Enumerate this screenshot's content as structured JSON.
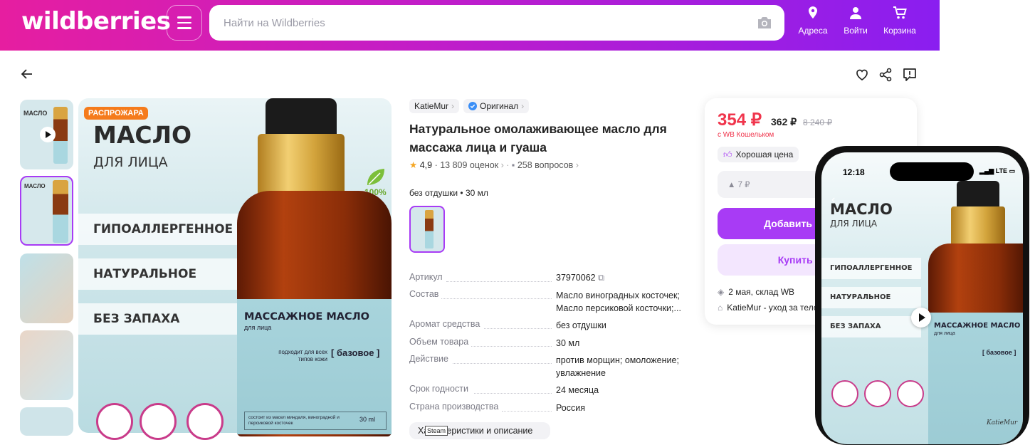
{
  "header": {
    "logo": "wildberries",
    "search_placeholder": "Найти на Wildberries",
    "actions": [
      {
        "label": "Адреса",
        "icon": "location-pin-icon"
      },
      {
        "label": "Войти",
        "icon": "user-icon"
      },
      {
        "label": "Корзина",
        "icon": "cart-icon"
      }
    ]
  },
  "gallery": {
    "badge": "РАСПРОЖАРА",
    "title_line1": "МАСЛО",
    "title_line2": "ДЛЯ ЛИЦА",
    "features": [
      "ГИПОАЛЛЕРГЕННОЕ",
      "НАТУРАЛЬНОЕ",
      "БЕЗ ЗАПАХА"
    ],
    "eco_label": "100%",
    "bottle_title": "МАССАЖНОЕ МАСЛО",
    "bottle_subtitle": "для лица",
    "bottle_skin": "подходит для всех типов кожи",
    "bottle_base": "[ базовое ]",
    "bottle_compo": "состоит из масел миндаля, виноградной и персиковой косточек",
    "bottle_volume": "30 ml"
  },
  "product": {
    "brand": "KatieMur",
    "original": "Оригинал",
    "title": "Натуральное омолаживающее масло для массажа лица и гуаша",
    "rating": "4,9",
    "reviews": "13 809 оценок",
    "questions": "258 вопросов",
    "variant": "без отдушки • 30 мл",
    "specs": [
      {
        "key": "Артикул",
        "value": "37970062"
      },
      {
        "key": "Состав",
        "value": "Масло виноградных косточек; Масло персиковой косточки;..."
      },
      {
        "key": "Аромат средства",
        "value": "без отдушки"
      },
      {
        "key": "Объем товара",
        "value": "30 мл"
      },
      {
        "key": "Действие",
        "value": "против морщин; омоложение; увлажнение"
      },
      {
        "key": "Срок годности",
        "value": "24 месяца"
      },
      {
        "key": "Страна производства",
        "value": "Россия"
      }
    ],
    "more_button": "Характеристики и описание",
    "tooltip": "Steam"
  },
  "buy": {
    "price": "354 ₽",
    "price_regular": "362 ₽",
    "price_old": "8 240 ₽",
    "wallet_note": "с WB Кошельком",
    "good_price": "Хорошая цена",
    "cashback": "▲ 7 ₽",
    "add_button": "Добавить в корзину",
    "buy_button": "Купить сейчас",
    "delivery": "2 мая, склад WB",
    "seller": "KatieMur - уход за телом"
  },
  "phone": {
    "time": "12:18",
    "status": "LTE",
    "brand_sign": "KatieMur"
  },
  "colors": {
    "accent": "#a83bf5",
    "price": "#f0354c",
    "badge": "#f57b1c"
  }
}
